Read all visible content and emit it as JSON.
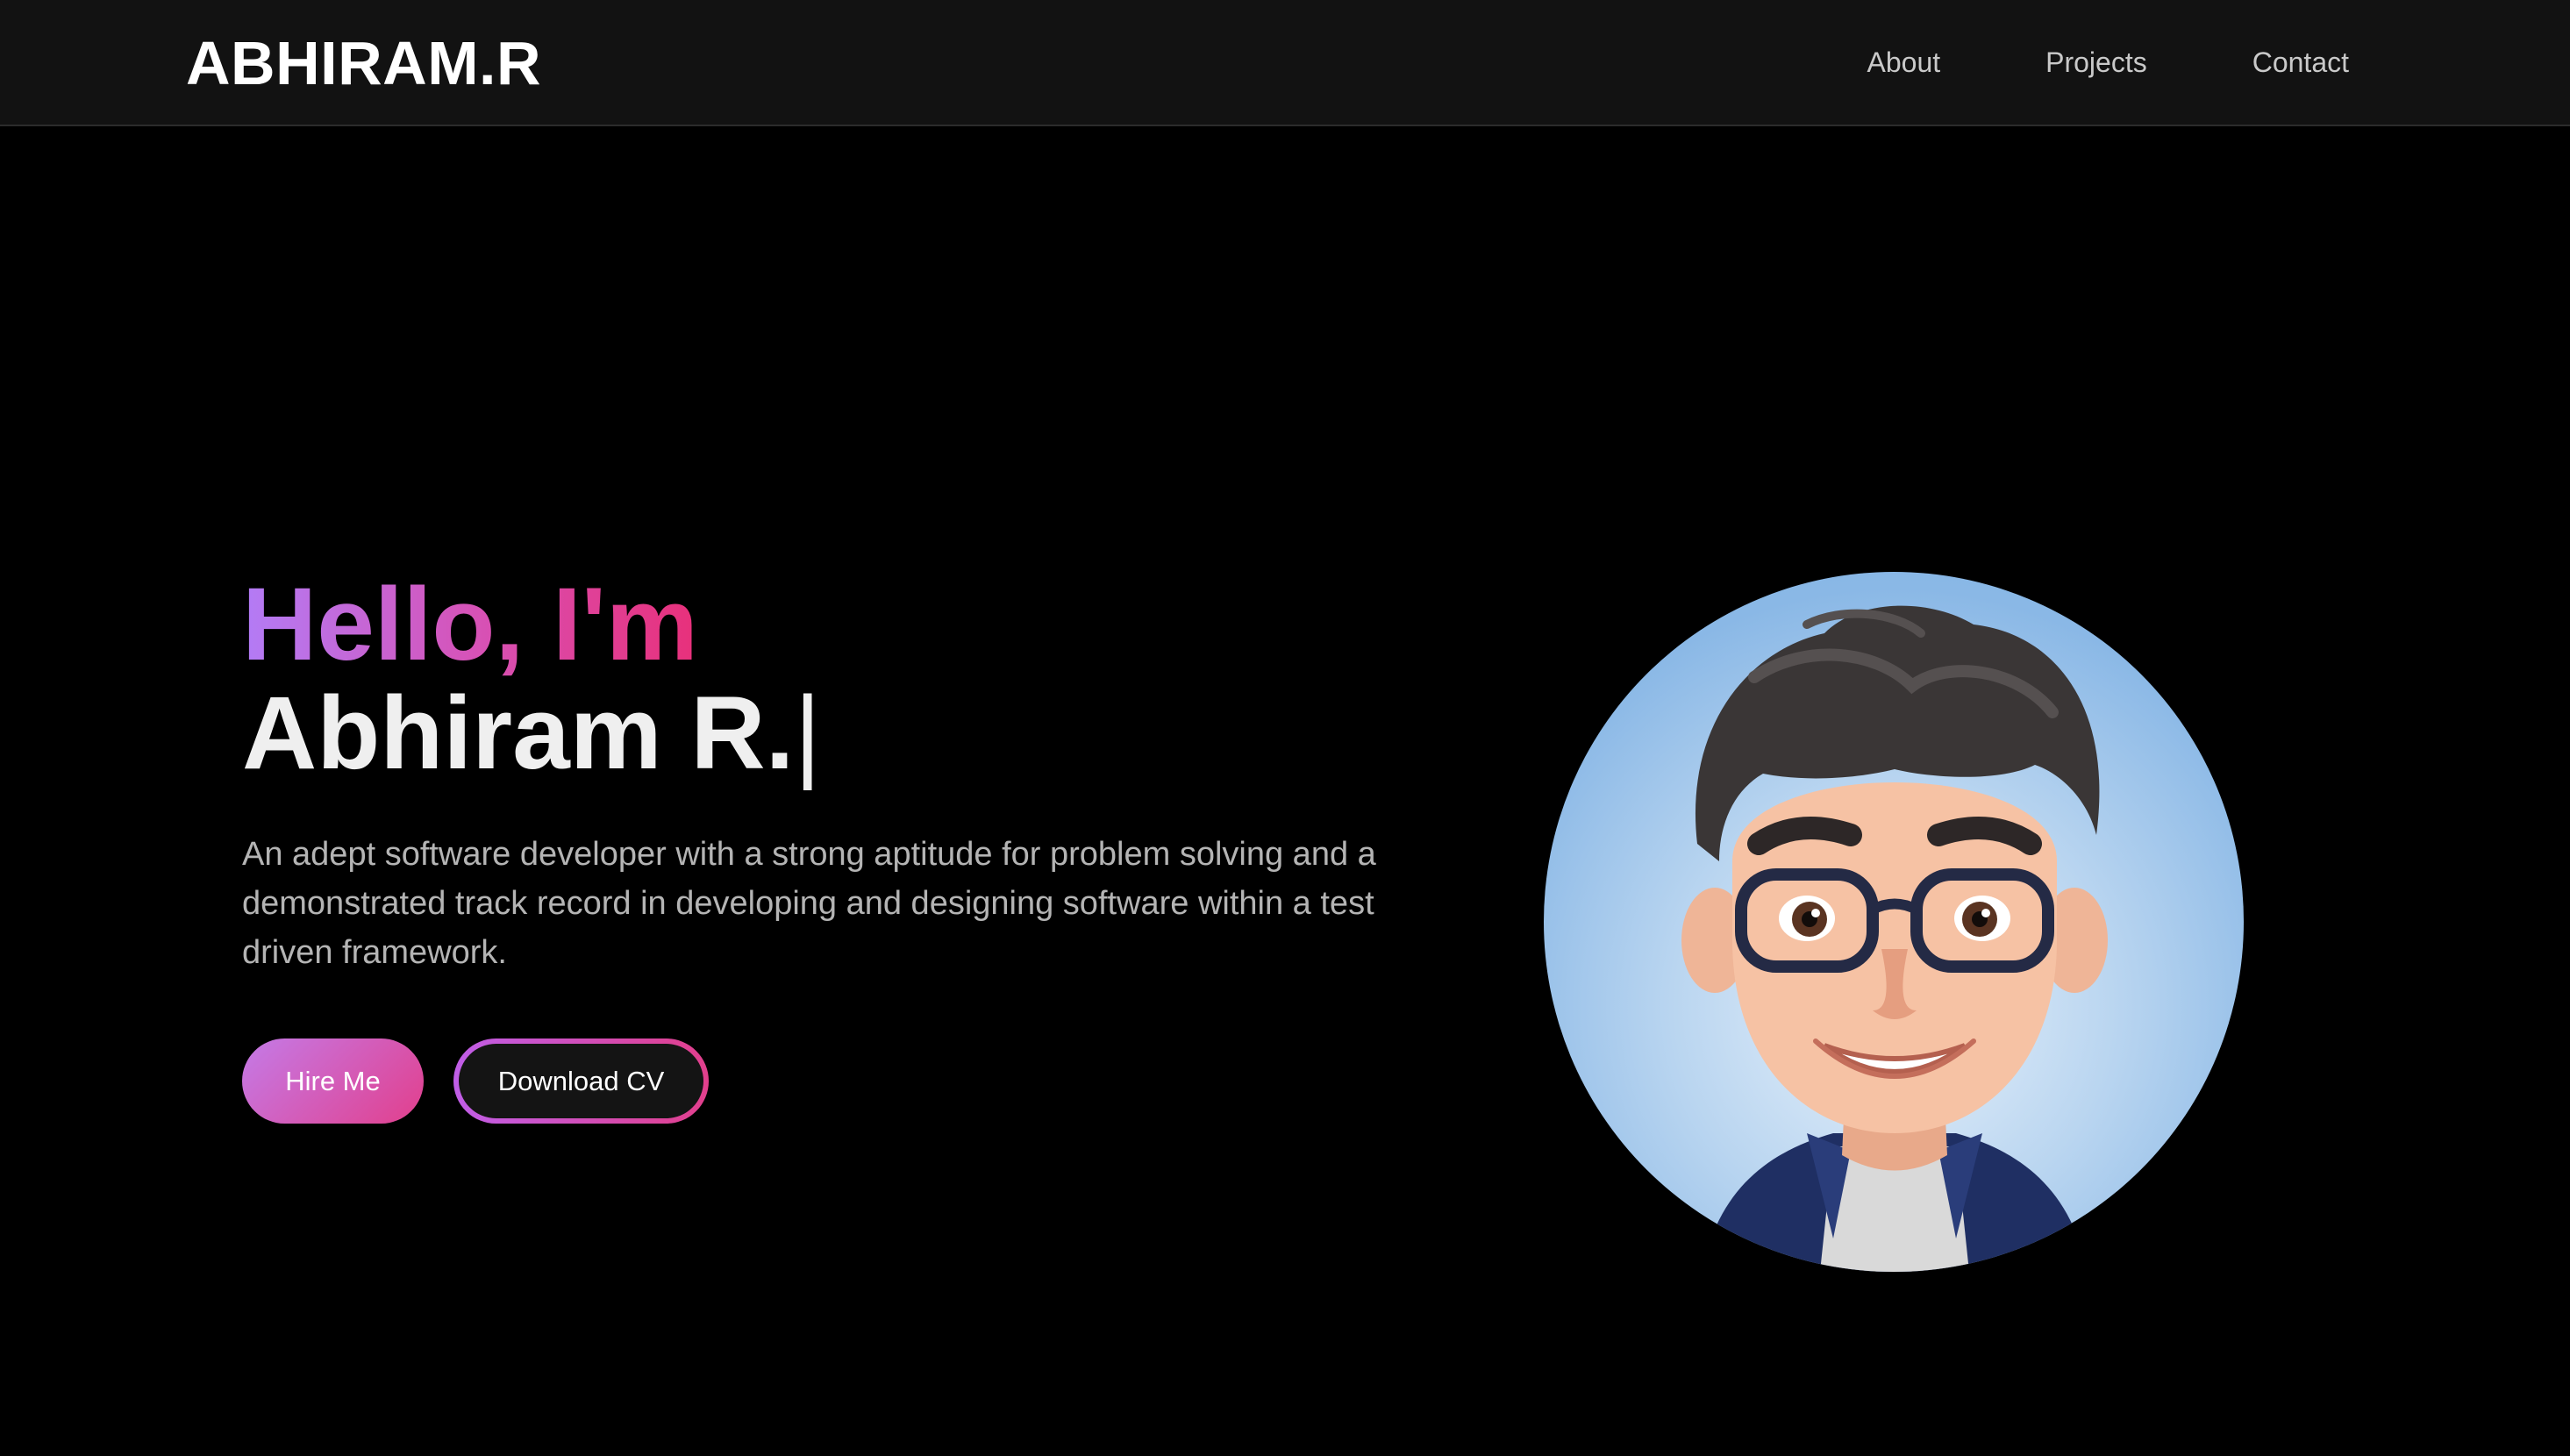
{
  "header": {
    "logo": "ABHIRAM.R",
    "nav": [
      {
        "label": "About"
      },
      {
        "label": "Projects"
      },
      {
        "label": "Contact"
      }
    ]
  },
  "hero": {
    "greeting": "Hello, I'm",
    "name": "Abhiram R.",
    "cursor": "|",
    "bio": "An adept software developer with a strong aptitude for problem solving and a demonstrated track record in developing and designing software within a test driven framework.",
    "buttons": {
      "hire": "Hire Me",
      "cv": "Download CV"
    }
  },
  "colors": {
    "background": "#000000",
    "navbar": "#121212",
    "gradient_start": "#b37cf6",
    "gradient_end": "#e8307a",
    "text_primary": "#efefef",
    "text_muted": "#b4b4b4"
  },
  "icons": {
    "avatar": "cartoon-avatar-icon"
  }
}
